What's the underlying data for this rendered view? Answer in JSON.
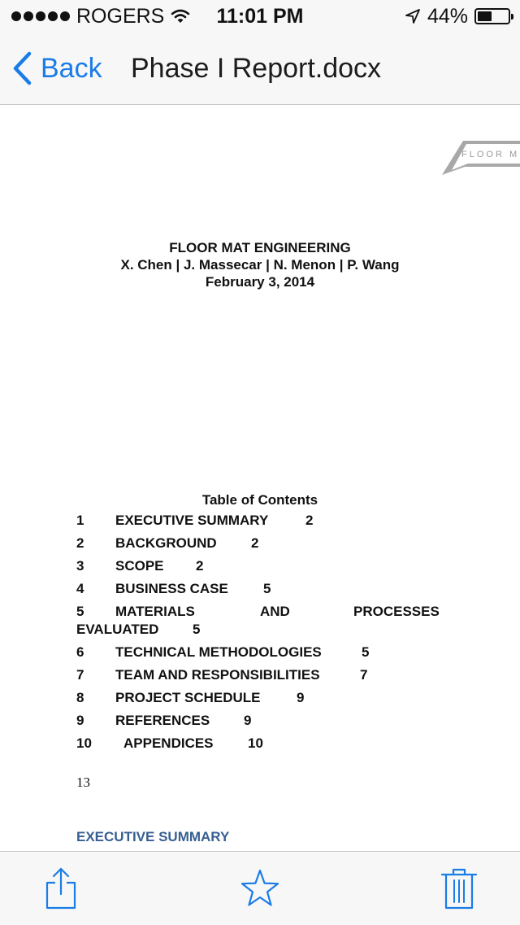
{
  "status_bar": {
    "carrier": "ROGERS",
    "time": "11:01 PM",
    "battery_percent": "44%",
    "battery_level": 0.44,
    "icons": [
      "signal-dots-icon",
      "wifi-icon",
      "location-arrow-icon",
      "battery-icon"
    ]
  },
  "nav": {
    "back_label": "Back",
    "title": "Phase I Report.docx"
  },
  "document": {
    "logo_text": "FLOOR M",
    "cover": {
      "title": "FLOOR MAT ENGINEERING",
      "authors": "X. Chen | J. Massecar | N. Menon | P. Wang",
      "date": "February 3, 2014"
    },
    "toc": {
      "heading": "Table of Contents",
      "rows": [
        {
          "num": "1",
          "title": "EXECUTIVE SUMMARY",
          "page": "2"
        },
        {
          "num": "2",
          "title": "BACKGROUND",
          "page": "2"
        },
        {
          "num": "3",
          "title": "SCOPE",
          "page": "2"
        },
        {
          "num": "4",
          "title": "BUSINESS CASE",
          "page": "5"
        },
        {
          "num": "5",
          "title_words": [
            "MATERIALS",
            "AND",
            "PROCESSES",
            "EVALUATED"
          ],
          "page": "5"
        },
        {
          "num": "6",
          "title": "TECHNICAL METHODOLOGIES",
          "page": "5"
        },
        {
          "num": "7",
          "title": "TEAM AND RESPONSIBILITIES",
          "page": "7"
        },
        {
          "num": "8",
          "title": "PROJECT SCHEDULE",
          "page": "9"
        },
        {
          "num": "9",
          "title": "REFERENCES",
          "page": "9"
        },
        {
          "num": "10",
          "title": "APPENDICES",
          "page": "10"
        }
      ]
    },
    "page_number": "13",
    "section_heading": "EXECUTIVE SUMMARY"
  },
  "toolbar": {
    "icons": [
      "share-icon",
      "star-icon",
      "trash-icon"
    ],
    "accent_color": "#1a7ce6"
  }
}
